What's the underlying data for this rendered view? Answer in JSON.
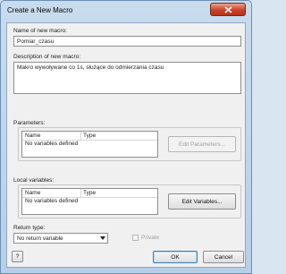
{
  "window": {
    "title": "Create a New Macro"
  },
  "macro": {
    "name_label": "Name of new macro:",
    "name_value": "Pomiar_czasu",
    "description_label": "Description of new macro:",
    "description_value": "Makro wywoływane co 1s, służące do odmierzania czasu"
  },
  "parameters": {
    "label": "Parameters:",
    "columns": [
      "Name",
      "Type"
    ],
    "empty_text": "No variables defined",
    "edit_button": "Edit Parameters..."
  },
  "local_variables": {
    "label": "Local variables:",
    "columns": [
      "Name",
      "Type"
    ],
    "empty_text": "No variables defined",
    "edit_button": "Edit Variables..."
  },
  "return_type": {
    "label": "Return type:",
    "selected": "No return variable"
  },
  "private_checkbox": {
    "label": "Private",
    "checked": false
  },
  "footer": {
    "help_label": "?",
    "ok_label": "OK",
    "cancel_label": "Cancel"
  },
  "icons": {
    "close": "close-icon"
  }
}
